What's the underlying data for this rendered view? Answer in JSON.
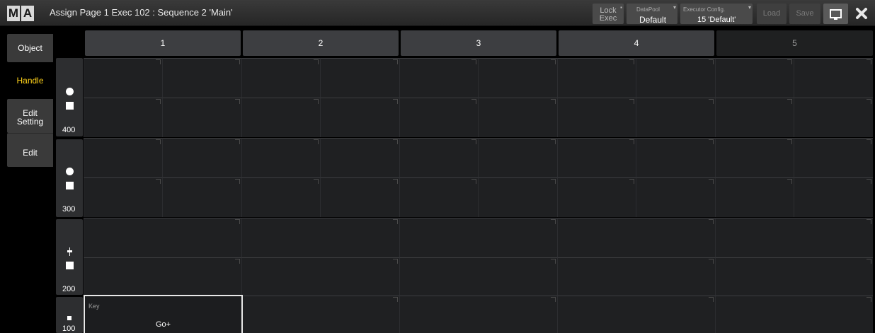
{
  "titlebar": {
    "logo": [
      "M",
      "A"
    ],
    "title": "Assign Page 1 Exec 102 : Sequence 2 'Main'",
    "lock_exec": "Lock\nExec",
    "datapool_label": "DataPool",
    "datapool_value": "Default",
    "exec_config_label": "Executor Config.",
    "exec_config_value": "15 'Default'",
    "load": "Load",
    "save": "Save",
    "icons": {
      "screen": "monitor-icon",
      "close": "close-icon"
    }
  },
  "tabs": {
    "object": "Object",
    "handle": "Handle",
    "edit_setting": "Edit\nSetting",
    "edit": "Edit"
  },
  "columns": [
    "1",
    "2",
    "3",
    "4",
    "5"
  ],
  "rows": [
    {
      "label": "400",
      "icons": [
        "circle-icon",
        "square-icon"
      ]
    },
    {
      "label": "300",
      "icons": [
        "circle-icon",
        "square-icon"
      ]
    },
    {
      "label": "200",
      "icons": [
        "fader-icon",
        "square-icon"
      ]
    },
    {
      "label": "100",
      "icons": [
        "small-square-icon"
      ]
    }
  ],
  "key_cell": {
    "caption": "Key",
    "function": "Go+"
  },
  "colors": {
    "accent_handle": "#ffd21a",
    "background": "#000000",
    "cell": "#1f2022",
    "header": "#3d3e41"
  }
}
